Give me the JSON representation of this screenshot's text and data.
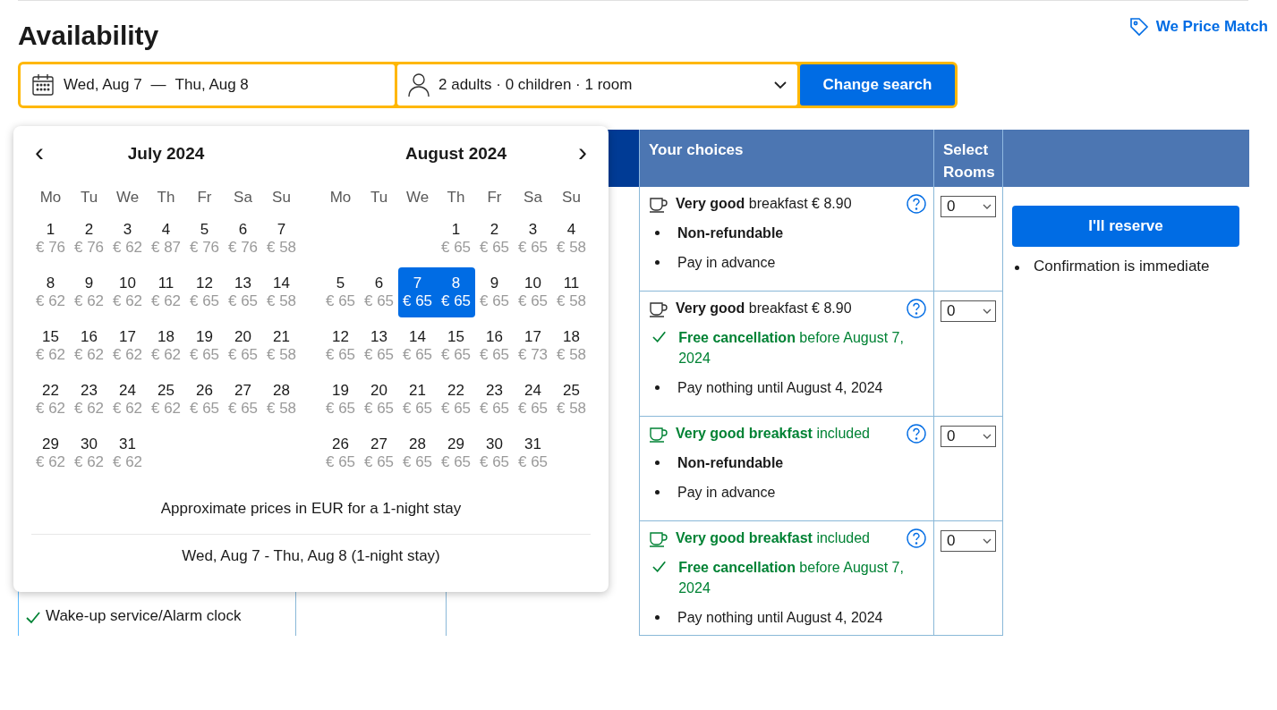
{
  "header": {
    "title": "Availability",
    "price_match": "We Price Match"
  },
  "search": {
    "date_start": "Wed, Aug 7",
    "dash": "—",
    "date_end": "Thu, Aug 8",
    "guests": "2 adults · 0 children · 1 room",
    "button": "Change search"
  },
  "calendar": {
    "prev": "‹",
    "next": "›",
    "months": [
      {
        "title": "July 2024",
        "weekdays": [
          "Mo",
          "Tu",
          "We",
          "Th",
          "Fr",
          "Sa",
          "Su"
        ],
        "weeks": [
          [
            {
              "kind": "day",
              "day": "1",
              "price": "€ 76",
              "selected": false
            },
            {
              "kind": "day",
              "day": "2",
              "price": "€ 76",
              "selected": false
            },
            {
              "kind": "day",
              "day": "3",
              "price": "€ 62",
              "selected": false
            },
            {
              "kind": "day",
              "day": "4",
              "price": "€ 87",
              "selected": false
            },
            {
              "kind": "day",
              "day": "5",
              "price": "€ 76",
              "selected": false
            },
            {
              "kind": "day",
              "day": "6",
              "price": "€ 76",
              "selected": false
            },
            {
              "kind": "day",
              "day": "7",
              "price": "€ 58",
              "selected": false
            }
          ],
          [
            {
              "kind": "day",
              "day": "8",
              "price": "€ 62",
              "selected": false
            },
            {
              "kind": "day",
              "day": "9",
              "price": "€ 62",
              "selected": false
            },
            {
              "kind": "day",
              "day": "10",
              "price": "€ 62",
              "selected": false
            },
            {
              "kind": "day",
              "day": "11",
              "price": "€ 62",
              "selected": false
            },
            {
              "kind": "day",
              "day": "12",
              "price": "€ 65",
              "selected": false
            },
            {
              "kind": "day",
              "day": "13",
              "price": "€ 65",
              "selected": false
            },
            {
              "kind": "day",
              "day": "14",
              "price": "€ 58",
              "selected": false
            }
          ],
          [
            {
              "kind": "day",
              "day": "15",
              "price": "€ 62",
              "selected": false
            },
            {
              "kind": "day",
              "day": "16",
              "price": "€ 62",
              "selected": false
            },
            {
              "kind": "day",
              "day": "17",
              "price": "€ 62",
              "selected": false
            },
            {
              "kind": "day",
              "day": "18",
              "price": "€ 62",
              "selected": false
            },
            {
              "kind": "day",
              "day": "19",
              "price": "€ 65",
              "selected": false
            },
            {
              "kind": "day",
              "day": "20",
              "price": "€ 65",
              "selected": false
            },
            {
              "kind": "day",
              "day": "21",
              "price": "€ 58",
              "selected": false
            }
          ],
          [
            {
              "kind": "day",
              "day": "22",
              "price": "€ 62",
              "selected": false
            },
            {
              "kind": "day",
              "day": "23",
              "price": "€ 62",
              "selected": false
            },
            {
              "kind": "day",
              "day": "24",
              "price": "€ 62",
              "selected": false
            },
            {
              "kind": "day",
              "day": "25",
              "price": "€ 62",
              "selected": false
            },
            {
              "kind": "day",
              "day": "26",
              "price": "€ 65",
              "selected": false
            },
            {
              "kind": "day",
              "day": "27",
              "price": "€ 65",
              "selected": false
            },
            {
              "kind": "day",
              "day": "28",
              "price": "€ 58",
              "selected": false
            }
          ],
          [
            {
              "kind": "day",
              "day": "29",
              "price": "€ 62",
              "selected": false
            },
            {
              "kind": "day",
              "day": "30",
              "price": "€ 62",
              "selected": false
            },
            {
              "kind": "day",
              "day": "31",
              "price": "€ 62",
              "selected": false
            }
          ]
        ]
      },
      {
        "title": "August 2024",
        "weekdays": [
          "Mo",
          "Tu",
          "We",
          "Th",
          "Fr",
          "Sa",
          "Su"
        ],
        "weeks": [
          [
            {
              "kind": "empty"
            },
            {
              "kind": "empty"
            },
            {
              "kind": "empty"
            },
            {
              "kind": "day",
              "day": "1",
              "price": "€ 65",
              "selected": false
            },
            {
              "kind": "day",
              "day": "2",
              "price": "€ 65",
              "selected": false
            },
            {
              "kind": "day",
              "day": "3",
              "price": "€ 65",
              "selected": false
            },
            {
              "kind": "day",
              "day": "4",
              "price": "€ 58",
              "selected": false
            }
          ],
          [
            {
              "kind": "day",
              "day": "5",
              "price": "€ 65",
              "selected": false
            },
            {
              "kind": "day",
              "day": "6",
              "price": "€ 65",
              "selected": false
            },
            {
              "kind": "day",
              "day": "7",
              "price": "€ 65",
              "selected": true
            },
            {
              "kind": "day",
              "day": "8",
              "price": "€ 65",
              "selected": true
            },
            {
              "kind": "day",
              "day": "9",
              "price": "€ 65",
              "selected": false
            },
            {
              "kind": "day",
              "day": "10",
              "price": "€ 65",
              "selected": false
            },
            {
              "kind": "day",
              "day": "11",
              "price": "€ 58",
              "selected": false
            }
          ],
          [
            {
              "kind": "day",
              "day": "12",
              "price": "€ 65",
              "selected": false
            },
            {
              "kind": "day",
              "day": "13",
              "price": "€ 65",
              "selected": false
            },
            {
              "kind": "day",
              "day": "14",
              "price": "€ 65",
              "selected": false
            },
            {
              "kind": "day",
              "day": "15",
              "price": "€ 65",
              "selected": false
            },
            {
              "kind": "day",
              "day": "16",
              "price": "€ 65",
              "selected": false
            },
            {
              "kind": "day",
              "day": "17",
              "price": "€ 73",
              "selected": false
            },
            {
              "kind": "day",
              "day": "18",
              "price": "€ 58",
              "selected": false
            }
          ],
          [
            {
              "kind": "day",
              "day": "19",
              "price": "€ 65",
              "selected": false
            },
            {
              "kind": "day",
              "day": "20",
              "price": "€ 65",
              "selected": false
            },
            {
              "kind": "day",
              "day": "21",
              "price": "€ 65",
              "selected": false
            },
            {
              "kind": "day",
              "day": "22",
              "price": "€ 65",
              "selected": false
            },
            {
              "kind": "day",
              "day": "23",
              "price": "€ 65",
              "selected": false
            },
            {
              "kind": "day",
              "day": "24",
              "price": "€ 65",
              "selected": false
            },
            {
              "kind": "day",
              "day": "25",
              "price": "€ 58",
              "selected": false
            }
          ],
          [
            {
              "kind": "day",
              "day": "26",
              "price": "€ 65",
              "selected": false
            },
            {
              "kind": "day",
              "day": "27",
              "price": "€ 65",
              "selected": false
            },
            {
              "kind": "day",
              "day": "28",
              "price": "€ 65",
              "selected": false
            },
            {
              "kind": "day",
              "day": "29",
              "price": "€ 65",
              "selected": false
            },
            {
              "kind": "day",
              "day": "30",
              "price": "€ 65",
              "selected": false
            },
            {
              "kind": "day",
              "day": "31",
              "price": "€ 65",
              "selected": false
            }
          ]
        ]
      }
    ],
    "note": "Approximate prices in EUR for a 1-night stay",
    "summary": "Wed, Aug 7 - Thu, Aug 8 (1-night stay)"
  },
  "table": {
    "columns": [
      "Your choices",
      "Select Rooms"
    ],
    "amenities": [
      {
        "label": "Wake-up service/Alarm clock"
      }
    ],
    "choices": [
      {
        "meal": {
          "text": "**Very good** breakfast € 8.90",
          "included": false
        },
        "conditions": [
          {
            "kind": "bullet",
            "text": "Non-refundable",
            "strong": true
          },
          {
            "kind": "bullet",
            "text": "Pay in advance",
            "strong": false
          }
        ],
        "rooms": "0"
      },
      {
        "meal": {
          "text": "**Very good** breakfast € 8.90",
          "included": false
        },
        "conditions": [
          {
            "kind": "check",
            "text": "**Free cancellation** before August 7, 2024",
            "strong": false
          },
          {
            "kind": "bullet",
            "text": "Pay nothing until August 4, 2024",
            "strong": false
          }
        ],
        "rooms": "0"
      },
      {
        "meal": {
          "text": "**Very good breakfast** included",
          "included": true
        },
        "conditions": [
          {
            "kind": "bullet",
            "text": "Non-refundable",
            "strong": true
          },
          {
            "kind": "bullet",
            "text": "Pay in advance",
            "strong": false
          }
        ],
        "rooms": "0"
      },
      {
        "meal": {
          "text": "**Very good breakfast** included",
          "included": true
        },
        "conditions": [
          {
            "kind": "check",
            "text": "**Free cancellation** before August 7, 2024",
            "strong": false
          },
          {
            "kind": "bullet",
            "text": "Pay nothing until August 4, 2024",
            "strong": false
          }
        ],
        "rooms": "0"
      }
    ],
    "reserve": {
      "button": "I'll reserve",
      "notes": [
        "Confirmation is immediate"
      ]
    }
  }
}
